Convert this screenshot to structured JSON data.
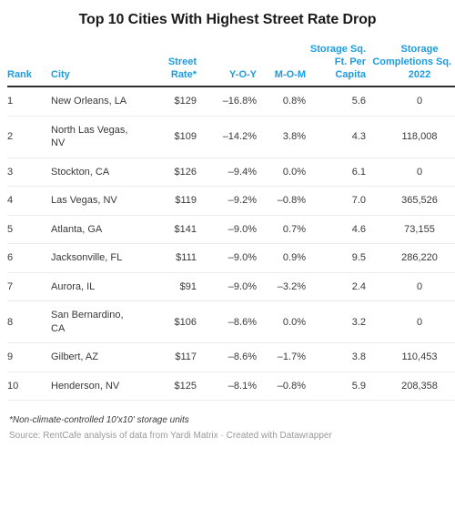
{
  "title": "Top 10 Cities With Highest Street Rate Drop",
  "accent_color": "#1b9ce2",
  "columns": [
    {
      "key": "rank",
      "label": "Rank"
    },
    {
      "key": "city",
      "label": "City"
    },
    {
      "key": "street_rate",
      "label": "Street Rate*"
    },
    {
      "key": "yoy",
      "label": "Y-O-Y"
    },
    {
      "key": "mom",
      "label": "M-O-M"
    },
    {
      "key": "sqft_per_capita",
      "label": "Storage Sq. Ft. Per Capita"
    },
    {
      "key": "completions",
      "label": "Storage Completions Sq. Ft. 2022"
    }
  ],
  "rows": [
    {
      "rank": "1",
      "city": "New Orleans, LA",
      "street_rate": "$129",
      "yoy": "–16.8%",
      "mom": "0.8%",
      "sqft_per_capita": "5.6",
      "completions": "0"
    },
    {
      "rank": "2",
      "city": "North Las Vegas, NV",
      "street_rate": "$109",
      "yoy": "–14.2%",
      "mom": "3.8%",
      "sqft_per_capita": "4.3",
      "completions": "118,008"
    },
    {
      "rank": "3",
      "city": "Stockton, CA",
      "street_rate": "$126",
      "yoy": "–9.4%",
      "mom": "0.0%",
      "sqft_per_capita": "6.1",
      "completions": "0"
    },
    {
      "rank": "4",
      "city": "Las Vegas, NV",
      "street_rate": "$119",
      "yoy": "–9.2%",
      "mom": "–0.8%",
      "sqft_per_capita": "7.0",
      "completions": "365,526"
    },
    {
      "rank": "5",
      "city": "Atlanta, GA",
      "street_rate": "$141",
      "yoy": "–9.0%",
      "mom": "0.7%",
      "sqft_per_capita": "4.6",
      "completions": "73,155"
    },
    {
      "rank": "6",
      "city": "Jacksonville, FL",
      "street_rate": "$111",
      "yoy": "–9.0%",
      "mom": "0.9%",
      "sqft_per_capita": "9.5",
      "completions": "286,220"
    },
    {
      "rank": "7",
      "city": "Aurora, IL",
      "street_rate": "$91",
      "yoy": "–9.0%",
      "mom": "–3.2%",
      "sqft_per_capita": "2.4",
      "completions": "0"
    },
    {
      "rank": "8",
      "city": "San Bernardino, CA",
      "street_rate": "$106",
      "yoy": "–8.6%",
      "mom": "0.0%",
      "sqft_per_capita": "3.2",
      "completions": "0"
    },
    {
      "rank": "9",
      "city": "Gilbert, AZ",
      "street_rate": "$117",
      "yoy": "–8.6%",
      "mom": "–1.7%",
      "sqft_per_capita": "3.8",
      "completions": "110,453"
    },
    {
      "rank": "10",
      "city": "Henderson, NV",
      "street_rate": "$125",
      "yoy": "–8.1%",
      "mom": "–0.8%",
      "sqft_per_capita": "5.9",
      "completions": "208,358"
    }
  ],
  "footnote": "*Non-climate-controlled 10'x10' storage units",
  "source": "Source: RentCafe analysis of data from Yardi Matrix · Created with Datawrapper",
  "chart_data": {
    "type": "table",
    "title": "Top 10 Cities With Highest Street Rate Drop",
    "columns": [
      "Rank",
      "City",
      "Street Rate*",
      "Y-O-Y",
      "M-O-M",
      "Storage Sq. Ft. Per Capita",
      "Storage Completions Sq. Ft. 2022"
    ],
    "rows": [
      [
        "1",
        "New Orleans, LA",
        "$129",
        "-16.8%",
        "0.8%",
        "5.6",
        "0"
      ],
      [
        "2",
        "North Las Vegas, NV",
        "$109",
        "-14.2%",
        "3.8%",
        "4.3",
        "118,008"
      ],
      [
        "3",
        "Stockton, CA",
        "$126",
        "-9.4%",
        "0.0%",
        "6.1",
        "0"
      ],
      [
        "4",
        "Las Vegas, NV",
        "$119",
        "-9.2%",
        "-0.8%",
        "7.0",
        "365,526"
      ],
      [
        "5",
        "Atlanta, GA",
        "$141",
        "-9.0%",
        "0.7%",
        "4.6",
        "73,155"
      ],
      [
        "6",
        "Jacksonville, FL",
        "$111",
        "-9.0%",
        "0.9%",
        "9.5",
        "286,220"
      ],
      [
        "7",
        "Aurora, IL",
        "$91",
        "-9.0%",
        "-3.2%",
        "2.4",
        "0"
      ],
      [
        "8",
        "San Bernardino, CA",
        "$106",
        "-8.6%",
        "0.0%",
        "3.2",
        "0"
      ],
      [
        "9",
        "Gilbert, AZ",
        "$117",
        "-8.6%",
        "-1.7%",
        "3.8",
        "110,453"
      ],
      [
        "10",
        "Henderson, NV",
        "$125",
        "-8.1%",
        "-0.8%",
        "5.9",
        "208,358"
      ]
    ],
    "series": [
      {
        "name": "Street Rate ($)",
        "values": [
          129,
          109,
          126,
          119,
          141,
          111,
          91,
          106,
          117,
          125
        ]
      },
      {
        "name": "Y-O-Y (%)",
        "values": [
          -16.8,
          -14.2,
          -9.4,
          -9.2,
          -9.0,
          -9.0,
          -9.0,
          -8.6,
          -8.6,
          -8.1
        ]
      },
      {
        "name": "M-O-M (%)",
        "values": [
          0.8,
          3.8,
          0.0,
          -0.8,
          0.7,
          0.9,
          -3.2,
          0.0,
          -1.7,
          -0.8
        ]
      },
      {
        "name": "Storage Sq. Ft. Per Capita",
        "values": [
          5.6,
          4.3,
          6.1,
          7.0,
          4.6,
          9.5,
          2.4,
          3.2,
          3.8,
          5.9
        ]
      },
      {
        "name": "Storage Completions Sq. Ft. 2022",
        "values": [
          0,
          118008,
          0,
          365526,
          73155,
          286220,
          0,
          0,
          110453,
          208358
        ]
      }
    ],
    "categories": [
      "New Orleans, LA",
      "North Las Vegas, NV",
      "Stockton, CA",
      "Las Vegas, NV",
      "Atlanta, GA",
      "Jacksonville, FL",
      "Aurora, IL",
      "San Bernardino, CA",
      "Gilbert, AZ",
      "Henderson, NV"
    ],
    "xlabel": "",
    "ylabel": "",
    "grid": false,
    "legend": "none",
    "footnote": "*Non-climate-controlled 10'x10' storage units",
    "source": "Source: RentCafe analysis of data from Yardi Matrix · Created with Datawrapper"
  }
}
